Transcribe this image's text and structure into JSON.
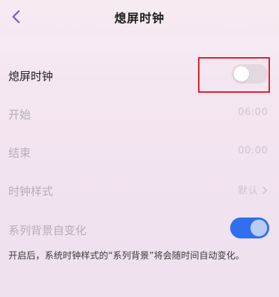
{
  "header": {
    "title": "熄屏时钟"
  },
  "settings": {
    "clock_toggle": {
      "label": "熄屏时钟",
      "enabled": false
    },
    "start": {
      "label": "开始",
      "value": "06:00"
    },
    "end": {
      "label": "结束",
      "value": "00:00"
    },
    "clock_style": {
      "label": "时钟样式",
      "value": "默认"
    },
    "series_background": {
      "label": "系列背景自变化",
      "enabled": true
    }
  },
  "description": "开启后，系统时钟样式的“系列背景”将会随时间自动变化。",
  "colors": {
    "toggle_on": "#2f6ff0",
    "toggle_off": "#e2d9e0",
    "highlight": "#e0161c",
    "back_icon": "#7a62c9"
  }
}
